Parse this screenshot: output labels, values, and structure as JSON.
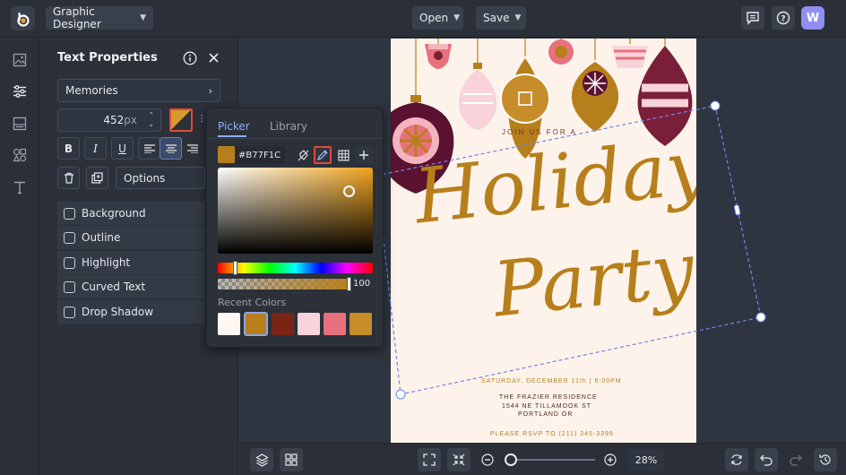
{
  "topbar": {
    "app_menu_label": "Graphic Designer",
    "open_label": "Open",
    "save_label": "Save",
    "avatar_initial": "W"
  },
  "panel": {
    "title": "Text Properties",
    "font_name": "Memories",
    "font_size": "452",
    "font_size_unit": "px",
    "options_label": "Options",
    "checkboxes": [
      {
        "label": "Background",
        "checked": false
      },
      {
        "label": "Outline",
        "checked": false
      },
      {
        "label": "Highlight",
        "checked": false
      },
      {
        "label": "Curved Text",
        "checked": false
      },
      {
        "label": "Drop Shadow",
        "checked": false
      }
    ],
    "text_color": "#B77F1C"
  },
  "color_picker": {
    "tabs": [
      "Picker",
      "Library"
    ],
    "active_tab": "Picker",
    "hex_value": "#B77F1C",
    "opacity_value": "100",
    "recent_colors_label": "Recent Colors",
    "recent_colors": [
      "#FFF7F2",
      "#B77F1C",
      "#7A2414",
      "#F9D3DA",
      "#E8717E",
      "#C68D2A"
    ],
    "gradient_hue_color": "#F0A31E"
  },
  "document": {
    "intro_line": "JOIN US FOR A",
    "headline_1": "Holiday",
    "headline_2": "Party",
    "date_line": "SATURDAY, DECEMBER 11th | 6:00PM",
    "venue_line": "THE FRAZIER RESIDENCE",
    "address_line_1": "1544 NE TILLAMOOK ST",
    "address_line_2": "PORTLAND OR",
    "rsvp_line": "PLEASE RSVP TO (211) 345-3399",
    "accent_color": "#B77F1C",
    "background_color": "#FDF3EA"
  },
  "bottombar": {
    "zoom_value": "28%"
  }
}
